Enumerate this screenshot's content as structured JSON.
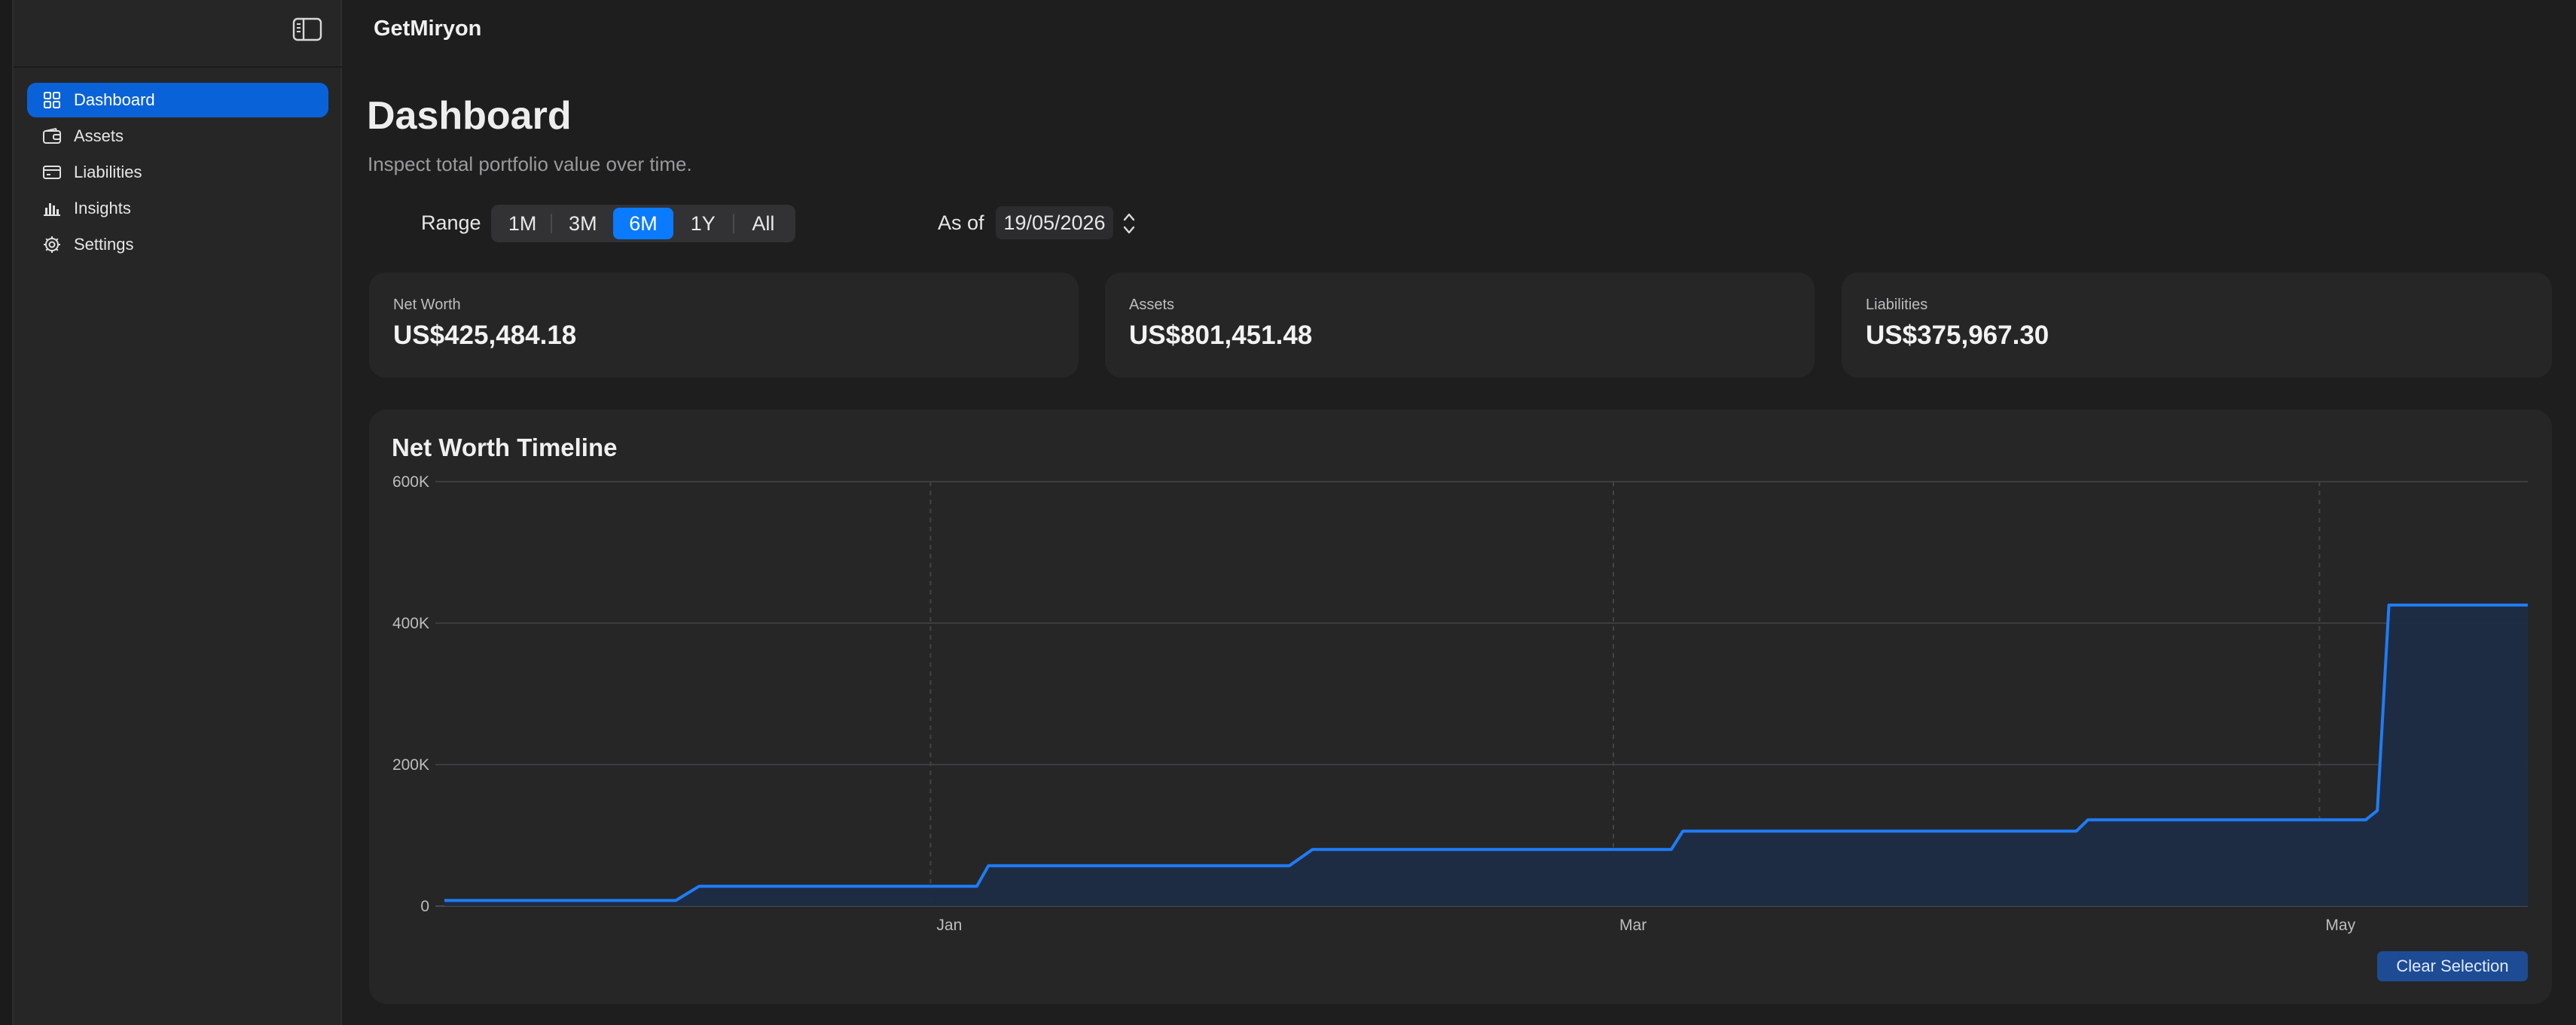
{
  "app": {
    "title": "GetMiryon"
  },
  "sidebar": {
    "items": [
      {
        "label": "Dashboard",
        "icon": "grid-icon",
        "active": true
      },
      {
        "label": "Assets",
        "icon": "wallet-icon",
        "active": false
      },
      {
        "label": "Liabilities",
        "icon": "credit-card-icon",
        "active": false
      },
      {
        "label": "Insights",
        "icon": "bar-chart-icon",
        "active": false
      },
      {
        "label": "Settings",
        "icon": "gear-icon",
        "active": false
      }
    ]
  },
  "header": {
    "title": "Dashboard",
    "subtitle": "Inspect total portfolio value over time."
  },
  "controls": {
    "range_label": "Range",
    "ranges": [
      "1M",
      "3M",
      "6M",
      "1Y",
      "All"
    ],
    "selected_range": "6M",
    "asof_label": "As of",
    "asof_value": "19/05/2026"
  },
  "stats": [
    {
      "label": "Net Worth",
      "value": "US$425,484.18"
    },
    {
      "label": "Assets",
      "value": "US$801,451.48"
    },
    {
      "label": "Liabilities",
      "value": "US$375,967.30"
    }
  ],
  "chart": {
    "title": "Net Worth Timeline",
    "clear_label": "Clear Selection"
  },
  "colors": {
    "accent": "#0a7aff",
    "active_nav": "#0a62d9",
    "line": "#1f7cf5",
    "area_fill": "#1d2c45"
  },
  "chart_data": {
    "type": "area",
    "title": "Net Worth Timeline",
    "xlabel": "",
    "ylabel": "",
    "ylim": [
      0,
      600000
    ],
    "y_ticks": [
      0,
      200000,
      400000,
      600000
    ],
    "y_tick_labels": [
      "0",
      "200K",
      "400K",
      "600K"
    ],
    "x_tick_labels": [
      "Jan",
      "Mar",
      "May"
    ],
    "x_tick_dates": [
      "2026-01-01",
      "2026-03-01",
      "2026-05-01"
    ],
    "xlim": [
      "2025-11-20",
      "2026-05-19"
    ],
    "grid": true,
    "series": [
      {
        "x": [
          "2025-11-20",
          "2025-12-10",
          "2025-12-12",
          "2026-01-05",
          "2026-01-06",
          "2026-02-01",
          "2026-02-03",
          "2026-03-06",
          "2026-03-07",
          "2026-04-10",
          "2026-04-11",
          "2026-05-05",
          "2026-05-06",
          "2026-05-07",
          "2026-05-19"
        ],
        "y": [
          8000,
          8000,
          28000,
          28000,
          57000,
          57000,
          80000,
          80000,
          106000,
          106000,
          122000,
          122000,
          135000,
          425484,
          425484
        ]
      }
    ]
  }
}
